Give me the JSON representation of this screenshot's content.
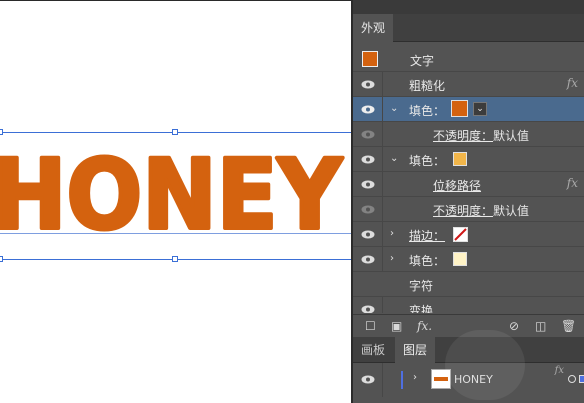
{
  "canvas": {
    "artwork_text": "HONEY",
    "text_color": "#D4620F"
  },
  "appearance_panel": {
    "tab_label": "外观",
    "header_label": "文字",
    "rows": [
      {
        "label": "粗糙化",
        "fx": "fx"
      },
      {
        "label": "填色：",
        "swatch_color": "#D4620F"
      },
      {
        "label": "不透明度：",
        "value": "默认值"
      },
      {
        "label": "填色：",
        "swatch_color": "#F2B64A"
      },
      {
        "label": "位移路径",
        "fx": "fx"
      },
      {
        "label": "不透明度：",
        "value": "默认值"
      },
      {
        "label": "描边："
      },
      {
        "label": "填色：",
        "swatch_color": "#FFF3C6"
      },
      {
        "label": "字符"
      },
      {
        "label": "变换"
      }
    ],
    "toolbar_fx": "fx."
  },
  "layers_panel": {
    "tabs": [
      "画板",
      "图层"
    ],
    "layer_name": "HONEY",
    "fx": "fx"
  }
}
